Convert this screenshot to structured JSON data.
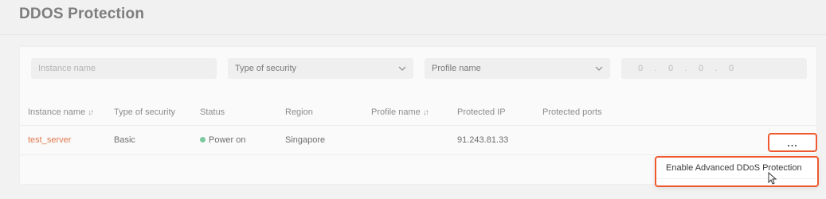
{
  "page": {
    "title": "DDOS Protection"
  },
  "filters": {
    "instance_name_placeholder": "Instance name",
    "type_of_security": "Type of security",
    "profile_name": "Profile name",
    "ip_placeholder": [
      "0",
      ".",
      "0",
      ".",
      "0",
      ".",
      "0"
    ]
  },
  "table": {
    "columns": [
      {
        "label": "Instance name",
        "sortable": true
      },
      {
        "label": "Type of security",
        "sortable": false
      },
      {
        "label": "Status",
        "sortable": false
      },
      {
        "label": "Region",
        "sortable": false
      },
      {
        "label": "Profile name",
        "sortable": true
      },
      {
        "label": "Protected IP",
        "sortable": false
      },
      {
        "label": "Protected ports",
        "sortable": false
      }
    ],
    "sort_icon": "↓↑",
    "rows": [
      {
        "instance_name": "test_server",
        "type_of_security": "Basic",
        "status": "Power on",
        "region": "Singapore",
        "profile_name": "",
        "protected_ip": "91.243.81.33",
        "protected_ports": ""
      }
    ]
  },
  "actions": {
    "more_label": "...",
    "menu_items": [
      "Enable Advanced DDoS Protection"
    ]
  },
  "colors": {
    "accent": "#ee5a2f",
    "link": "#e07a50",
    "status_on": "#7cc9a0"
  }
}
